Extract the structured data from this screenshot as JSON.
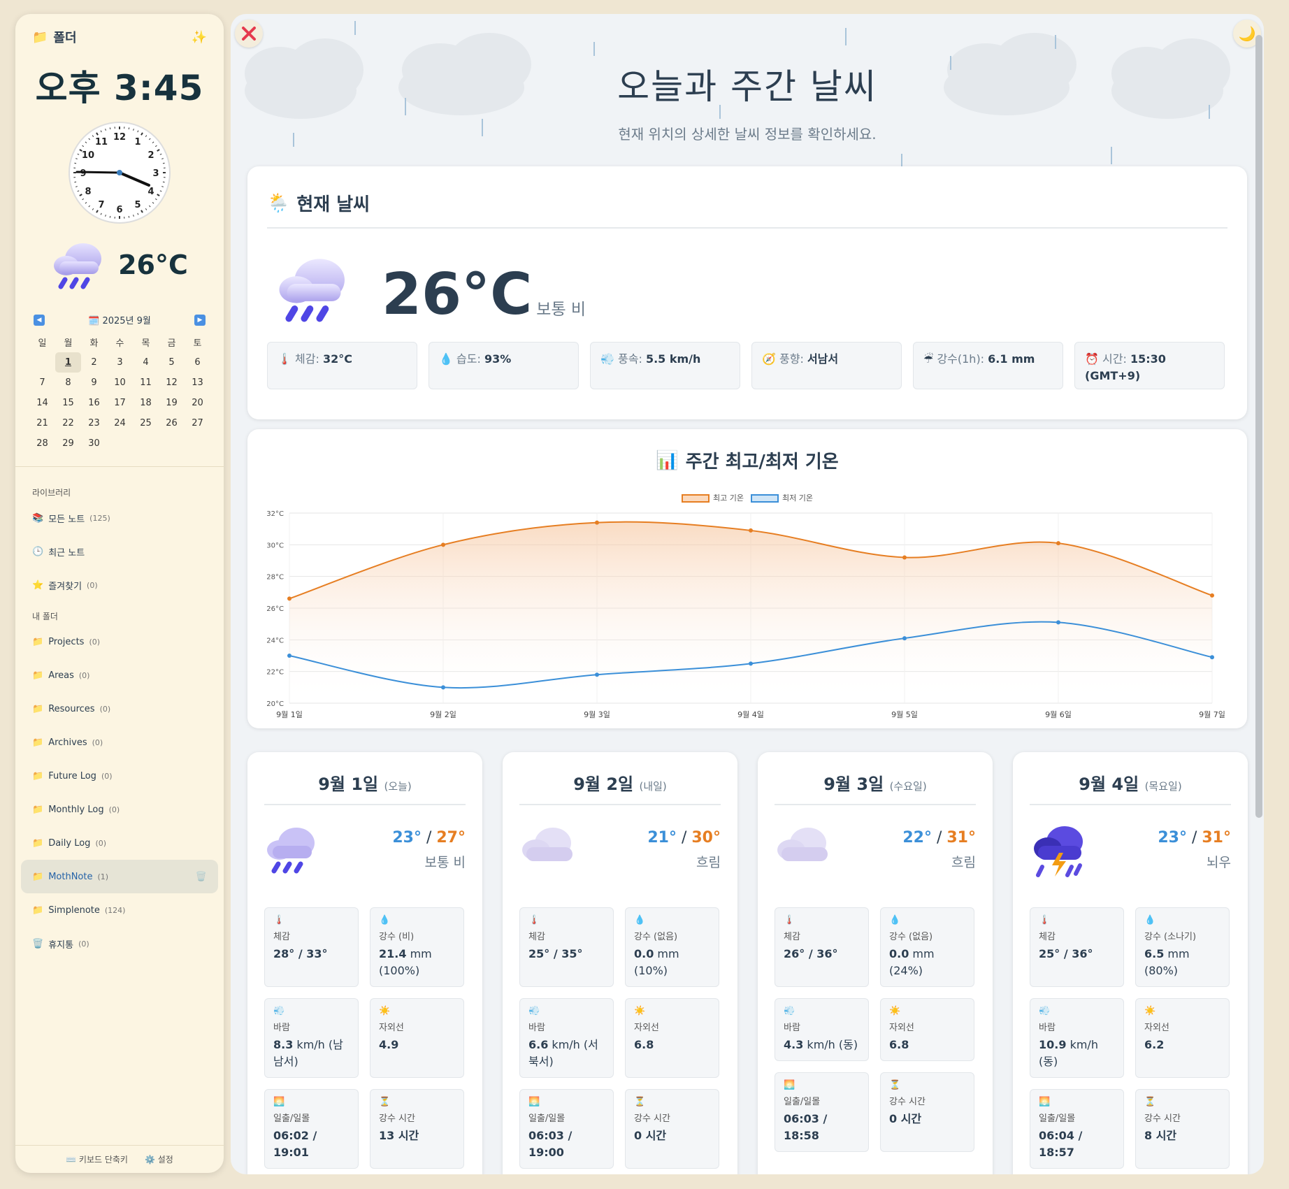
{
  "sidebar": {
    "folder_title": "폴더",
    "time": "오후 3:45",
    "temp": "26°C",
    "calendar": {
      "month_label": "2025년 9월",
      "dows": [
        "일",
        "월",
        "화",
        "수",
        "목",
        "금",
        "토"
      ],
      "days": [
        "",
        "1",
        "2",
        "3",
        "4",
        "5",
        "6",
        "7",
        "8",
        "9",
        "10",
        "11",
        "12",
        "13",
        "14",
        "15",
        "16",
        "17",
        "18",
        "19",
        "20",
        "21",
        "22",
        "23",
        "24",
        "25",
        "26",
        "27",
        "28",
        "29",
        "30"
      ],
      "today": "1"
    },
    "library_title": "라이브러리",
    "library": [
      {
        "icon": "📚",
        "label": "모든 노트",
        "count": "(125)"
      },
      {
        "icon": "🕒",
        "label": "최근 노트",
        "count": ""
      },
      {
        "icon": "⭐",
        "label": "즐겨찾기",
        "count": "(0)"
      }
    ],
    "folders_title": "내 폴더",
    "folders": [
      {
        "label": "Projects",
        "count": "(0)"
      },
      {
        "label": "Areas",
        "count": "(0)"
      },
      {
        "label": "Resources",
        "count": "(0)"
      },
      {
        "label": "Archives",
        "count": "(0)"
      },
      {
        "label": "Future Log",
        "count": "(0)"
      },
      {
        "label": "Monthly Log",
        "count": "(0)"
      },
      {
        "label": "Daily Log",
        "count": "(0)"
      },
      {
        "label": "MothNote",
        "count": "(1)",
        "active": true
      },
      {
        "label": "Simplenote",
        "count": "(124)"
      },
      {
        "label": "휴지통",
        "count": "(0)",
        "trash": true
      }
    ],
    "footer": {
      "shortcuts": "키보드 단축키",
      "settings": "설정"
    }
  },
  "main": {
    "title": "오늘과 주간 날씨",
    "subtitle": "현재 위치의 상세한 날씨 정보를 확인하세요.",
    "current": {
      "heading": "현재 날씨",
      "temp": "26°C",
      "desc": "보통 비",
      "details": [
        {
          "icon": "🌡️",
          "label": "체감:",
          "value": "32°C"
        },
        {
          "icon": "💧",
          "label": "습도:",
          "value": "93%"
        },
        {
          "icon": "💨",
          "label": "풍속:",
          "value": "5.5 km/h"
        },
        {
          "icon": "🧭",
          "label": "풍향:",
          "value": "서남서"
        },
        {
          "icon": "☔",
          "label": "강수(1h):",
          "value": "6.1 mm"
        },
        {
          "icon": "⏰",
          "label": "시간:",
          "value": "15:30 (GMT+9)"
        }
      ]
    },
    "chart_title": "주간 최고/최저 기온",
    "forecast": [
      {
        "date": "9월 1일",
        "rel": "(오늘)",
        "icon": "rain",
        "lo": "23°",
        "hi": "27°",
        "desc": "보통 비",
        "cells": [
          {
            "icon": "🌡️",
            "label": "체감",
            "value": "28° / 33°",
            "unit": ""
          },
          {
            "icon": "💧",
            "label": "강수 (비)",
            "value": "21.4",
            "unit": " mm (100%)"
          },
          {
            "icon": "💨",
            "label": "바람",
            "value": "8.3",
            "unit": " km/h (남남서)"
          },
          {
            "icon": "☀️",
            "label": "자외선",
            "value": "4.9",
            "unit": ""
          },
          {
            "icon": "🌅",
            "label": "일출/일몰",
            "value": "06:02 / 19:01",
            "unit": ""
          },
          {
            "icon": "⏳",
            "label": "강수 시간",
            "value": "13 시간",
            "unit": ""
          }
        ]
      },
      {
        "date": "9월 2일",
        "rel": "(내일)",
        "icon": "cloud",
        "lo": "21°",
        "hi": "30°",
        "desc": "흐림",
        "cells": [
          {
            "icon": "🌡️",
            "label": "체감",
            "value": "25° / 35°",
            "unit": ""
          },
          {
            "icon": "💧",
            "label": "강수 (없음)",
            "value": "0.0",
            "unit": " mm (10%)"
          },
          {
            "icon": "💨",
            "label": "바람",
            "value": "6.6",
            "unit": " km/h (서북서)"
          },
          {
            "icon": "☀️",
            "label": "자외선",
            "value": "6.8",
            "unit": ""
          },
          {
            "icon": "🌅",
            "label": "일출/일몰",
            "value": "06:03 / 19:00",
            "unit": ""
          },
          {
            "icon": "⏳",
            "label": "강수 시간",
            "value": "0 시간",
            "unit": ""
          }
        ]
      },
      {
        "date": "9월 3일",
        "rel": "(수요일)",
        "icon": "cloud",
        "lo": "22°",
        "hi": "31°",
        "desc": "흐림",
        "cells": [
          {
            "icon": "🌡️",
            "label": "체감",
            "value": "26° / 36°",
            "unit": ""
          },
          {
            "icon": "💧",
            "label": "강수 (없음)",
            "value": "0.0",
            "unit": " mm (24%)"
          },
          {
            "icon": "💨",
            "label": "바람",
            "value": "4.3",
            "unit": " km/h (동)"
          },
          {
            "icon": "☀️",
            "label": "자외선",
            "value": "6.8",
            "unit": ""
          },
          {
            "icon": "🌅",
            "label": "일출/일몰",
            "value": "06:03 / 18:58",
            "unit": ""
          },
          {
            "icon": "⏳",
            "label": "강수 시간",
            "value": "0 시간",
            "unit": ""
          }
        ]
      },
      {
        "date": "9월 4일",
        "rel": "(목요일)",
        "icon": "storm",
        "lo": "23°",
        "hi": "31°",
        "desc": "뇌우",
        "cells": [
          {
            "icon": "🌡️",
            "label": "체감",
            "value": "25° / 36°",
            "unit": ""
          },
          {
            "icon": "💧",
            "label": "강수 (소나기)",
            "value": "6.5",
            "unit": " mm (80%)"
          },
          {
            "icon": "💨",
            "label": "바람",
            "value": "10.9",
            "unit": " km/h (동)"
          },
          {
            "icon": "☀️",
            "label": "자외선",
            "value": "6.2",
            "unit": ""
          },
          {
            "icon": "🌅",
            "label": "일출/일몰",
            "value": "06:04 / 18:57",
            "unit": ""
          },
          {
            "icon": "⏳",
            "label": "강수 시간",
            "value": "8 시간",
            "unit": ""
          }
        ]
      }
    ]
  },
  "colors": {
    "high": "#e67e22",
    "low": "#3b8fd8",
    "accent": "#4a90e2"
  },
  "chart_data": {
    "type": "line",
    "title": "주간 최고/최저 기온",
    "categories": [
      "9월 1일",
      "9월 2일",
      "9월 3일",
      "9월 4일",
      "9월 5일",
      "9월 6일",
      "9월 7일"
    ],
    "yticks": [
      "20°C",
      "22°C",
      "24°C",
      "26°C",
      "28°C",
      "30°C",
      "32°C"
    ],
    "ylim": [
      20,
      32
    ],
    "grid": true,
    "legend": "top-center",
    "series": [
      {
        "name": "최고 기온",
        "values": [
          26.6,
          30.0,
          31.4,
          30.9,
          29.2,
          30.1,
          26.8
        ],
        "color": "#e67e22"
      },
      {
        "name": "최저 기온",
        "values": [
          23.0,
          21.0,
          21.8,
          22.5,
          24.1,
          25.1,
          22.9
        ],
        "color": "#3b8fd8"
      }
    ]
  }
}
